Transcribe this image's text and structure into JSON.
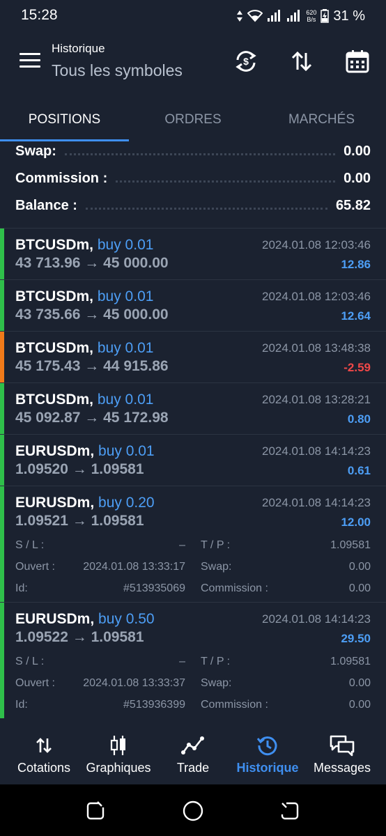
{
  "status_bar": {
    "time": "15:28",
    "net_speed_value": "620",
    "net_speed_unit": "B/s",
    "battery": "31 %"
  },
  "app_bar": {
    "title": "Historique",
    "subtitle": "Tous les symboles"
  },
  "tabs": [
    {
      "label": "POSITIONS",
      "active": true
    },
    {
      "label": "ORDRES",
      "active": false
    },
    {
      "label": "MARCHÉS",
      "active": false
    }
  ],
  "summary": [
    {
      "label": "Swap:",
      "value": "0.00"
    },
    {
      "label": "Commission :",
      "value": "0.00"
    },
    {
      "label": "Balance :",
      "value": "65.82"
    }
  ],
  "deals": [
    {
      "symbol": "BTCUSDm,",
      "direction": "buy 0.01",
      "time": "2024.01.08 12:03:46",
      "open_price": "43 713.96",
      "close_price": "45 000.00",
      "profit": "12.86",
      "profit_color": "#4d9ef5",
      "bar_color": "#2fbf4a"
    },
    {
      "symbol": "BTCUSDm,",
      "direction": "buy 0.01",
      "time": "2024.01.08 12:03:46",
      "open_price": "43 735.66",
      "close_price": "45 000.00",
      "profit": "12.64",
      "profit_color": "#4d9ef5",
      "bar_color": "#2fbf4a"
    },
    {
      "symbol": "BTCUSDm,",
      "direction": "buy 0.01",
      "time": "2024.01.08 13:48:38",
      "open_price": "45 175.43",
      "close_price": "44 915.86",
      "profit": "-2.59",
      "profit_color": "#f04848",
      "bar_color": "#f07a1a"
    },
    {
      "symbol": "BTCUSDm,",
      "direction": "buy 0.01",
      "time": "2024.01.08 13:28:21",
      "open_price": "45 092.87",
      "close_price": "45 172.98",
      "profit": "0.80",
      "profit_color": "#4d9ef5",
      "bar_color": "#2fbf4a"
    },
    {
      "symbol": "EURUSDm,",
      "direction": "buy 0.01",
      "time": "2024.01.08 14:14:23",
      "open_price": "1.09520",
      "close_price": "1.09581",
      "profit": "0.61",
      "profit_color": "#4d9ef5",
      "bar_color": "#2fbf4a"
    },
    {
      "symbol": "EURUSDm,",
      "direction": "buy 0.20",
      "time": "2024.01.08 14:14:23",
      "open_price": "1.09521",
      "close_price": "1.09581",
      "profit": "12.00",
      "profit_color": "#4d9ef5",
      "bar_color": "#2fbf4a",
      "details": {
        "sl_label": "S / L :",
        "sl_value": "–",
        "tp_label": "T / P :",
        "tp_value": "1.09581",
        "open_label": "Ouvert :",
        "open_value": "2024.01.08 13:33:17",
        "swap_label": "Swap:",
        "swap_value": "0.00",
        "id_label": "Id:",
        "id_value": "#513935069",
        "commission_label": "Commission :",
        "commission_value": "0.00"
      }
    },
    {
      "symbol": "EURUSDm,",
      "direction": "buy 0.50",
      "time": "2024.01.08 14:14:23",
      "open_price": "1.09522",
      "close_price": "1.09581",
      "profit": "29.50",
      "profit_color": "#4d9ef5",
      "bar_color": "#2fbf4a",
      "details": {
        "sl_label": "S / L :",
        "sl_value": "–",
        "tp_label": "T / P :",
        "tp_value": "1.09581",
        "open_label": "Ouvert :",
        "open_value": "2024.01.08 13:33:37",
        "swap_label": "Swap:",
        "swap_value": "0.00",
        "id_label": "Id:",
        "id_value": "#513936399",
        "commission_label": "Commission :",
        "commission_value": "0.00"
      }
    }
  ],
  "price_arrow": "→",
  "bottom_nav": [
    {
      "label": "Cotations",
      "icon": "swap-vertical-icon",
      "active": false
    },
    {
      "label": "Graphiques",
      "icon": "candlestick-icon",
      "active": false
    },
    {
      "label": "Trade",
      "icon": "trend-line-icon",
      "active": false
    },
    {
      "label": "Historique",
      "icon": "history-clock-icon",
      "active": true
    },
    {
      "label": "Messages",
      "icon": "chat-bubbles-icon",
      "active": false
    }
  ],
  "colors": {
    "accent": "#3f8ff0",
    "background": "#1b2230",
    "profit_positive": "#4d9ef5",
    "profit_negative": "#f04848"
  }
}
